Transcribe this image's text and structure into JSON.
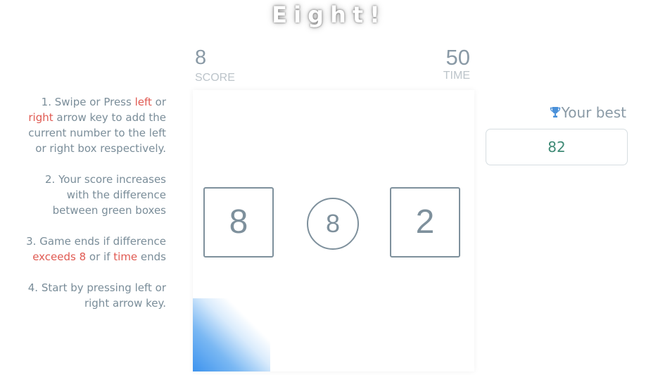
{
  "game": {
    "title": "Eight!"
  },
  "score": {
    "value": "8",
    "label": "SCORE"
  },
  "time": {
    "value": "50",
    "label": "TIME"
  },
  "instructions": {
    "step1": {
      "pre": "1. Swipe or Press ",
      "left": "left",
      "mid": " or ",
      "right": "right",
      "post": " arrow key to add the current number to the left or right box respectively."
    },
    "step2": "2. Your score increases with the difference between green boxes",
    "step3": {
      "pre": "3. Game ends if difference ",
      "exceeds": "exceeds 8",
      "mid": " or if ",
      "time": "time",
      "post": " ends"
    },
    "step4": "4. Start by pressing left or right arrow key."
  },
  "board": {
    "left_box": "8",
    "current_number": "8",
    "right_box": "2"
  },
  "best": {
    "label": "Your best",
    "value": "82",
    "icon": "trophy-icon"
  },
  "colors": {
    "highlight": "#e05a52",
    "text": "#7a8d99",
    "best_value": "#3f8a76",
    "trophy": "#4a90d9",
    "gradient": "#3d93ee"
  }
}
